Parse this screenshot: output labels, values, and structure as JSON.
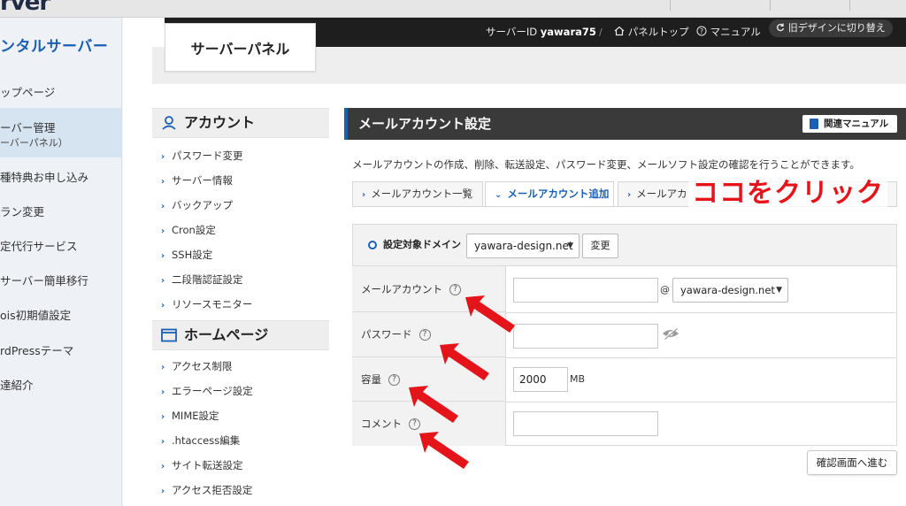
{
  "top": {
    "brand_fragment": "rver"
  },
  "left_sidebar": {
    "title": "ンタルサーバー",
    "items": [
      {
        "label": "ップページ"
      },
      {
        "label": "ーバー管理",
        "sub": "ーバーパネル）"
      },
      {
        "label": "種特典お申し込み"
      },
      {
        "label": "ラン変更"
      },
      {
        "label": "定代行サービス"
      },
      {
        "label": "サーバー簡単移行"
      },
      {
        "label": "ois初期値設定"
      },
      {
        "label": "rdPressテーマ"
      },
      {
        "label": "達紹介"
      }
    ]
  },
  "panel_header": {
    "logo_text": "サーバーパネル",
    "server_id_label": "サーバーID",
    "server_id_value": "yawara75",
    "separator": "/",
    "panel_top": "パネルトップ",
    "manual": "マニュアル",
    "old_design": "旧デザインに切り替え"
  },
  "menu": {
    "account_heading": "アカウント",
    "account_items": [
      "パスワード変更",
      "サーバー情報",
      "バックアップ",
      "Cron設定",
      "SSH設定",
      "二段階認証設定",
      "リソースモニター"
    ],
    "homepage_heading": "ホームページ",
    "homepage_items": [
      "アクセス制限",
      "エラーページ設定",
      "MIME設定",
      ".htaccess編集",
      "サイト転送設定",
      "アクセス拒否設定"
    ]
  },
  "content": {
    "title": "メールアカウント設定",
    "manual_button": "関連マニュアル",
    "description": "メールアカウントの作成、削除、転送設定、パスワード変更、メールソフト設定の確認を行うことができます。",
    "tabs": [
      {
        "label": "メールアカウント一覧",
        "active": false
      },
      {
        "label": "メールアカウント追加",
        "active": true
      },
      {
        "label": "メールアカ",
        "active": false
      },
      {
        "label": "",
        "active": false
      }
    ],
    "domain_label": "設定対象ドメイン",
    "domain_value": "yawara-design.net",
    "change_button": "変更",
    "form": {
      "mail_account_label": "メールアカウント",
      "mail_account_value": "",
      "at_sign": "@",
      "mail_domain_value": "yawara-design.net",
      "password_label": "パスワード",
      "password_value": "",
      "capacity_label": "容量",
      "capacity_value": "2000",
      "capacity_unit": "MB",
      "comment_label": "コメント",
      "comment_value": "",
      "help_glyph": "?"
    },
    "confirm_button": "確認画面へ進む"
  },
  "annotation": {
    "text": "ココをクリック",
    "color": "#e5141b"
  },
  "colors": {
    "accent": "#1a5fb4",
    "header_dark": "#1e1e1e",
    "title_dark": "#3a3a3a"
  }
}
